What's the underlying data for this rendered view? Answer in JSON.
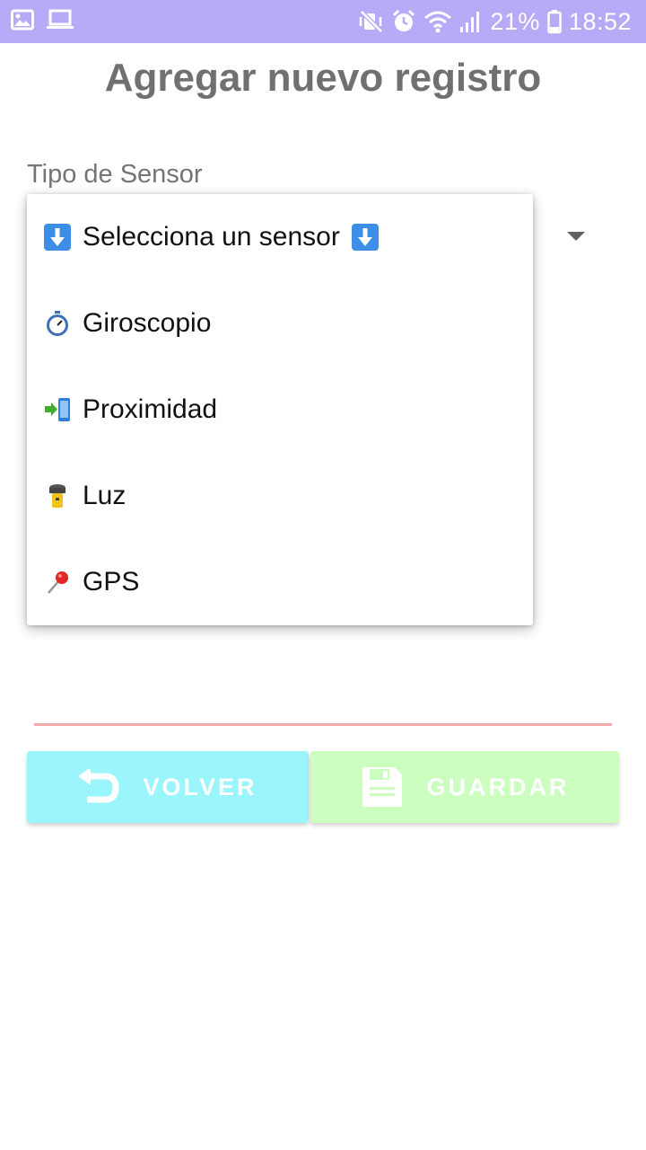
{
  "status_bar": {
    "battery_percent": "21%",
    "time": "18:52",
    "left_icons": [
      "image-icon",
      "laptop-icon"
    ],
    "right_icons": [
      "mute-icon",
      "alarm-icon",
      "wifi-icon",
      "signal-icon",
      "battery-icon"
    ]
  },
  "title": "Agregar nuevo registro",
  "field": {
    "label": "Tipo de Sensor"
  },
  "dropdown": {
    "options": [
      {
        "label": "Selecciona un sensor",
        "icon": "down-arrow-icon",
        "trailing_icon": "down-arrow-icon"
      },
      {
        "label": "Giroscopio",
        "icon": "stopwatch-icon"
      },
      {
        "label": "Proximidad",
        "icon": "phone-arrow-icon"
      },
      {
        "label": "Luz",
        "icon": "flashlight-icon"
      },
      {
        "label": "GPS",
        "icon": "pushpin-icon"
      }
    ]
  },
  "buttons": {
    "back_label": "VOLVER",
    "save_label": "GUARDAR"
  },
  "colors": {
    "status_bar": "#b9aaf8",
    "title": "#707070",
    "back_button": "#9bf5fd",
    "save_button": "#ccfebf",
    "input_underline": "#f1a8a8"
  }
}
